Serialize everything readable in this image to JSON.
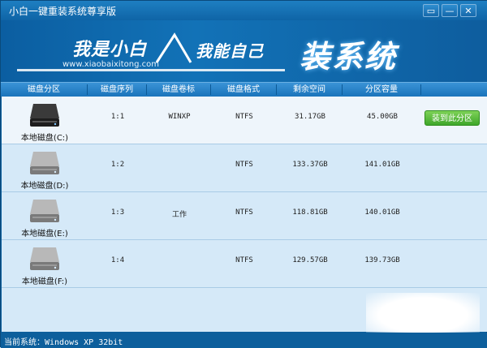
{
  "window": {
    "title": "小白一键重装系统尊享版",
    "controls": [
      "▭",
      "—",
      "✕"
    ]
  },
  "banner": {
    "slogan_left": "我是小白",
    "slogan_right": "我能自己",
    "site_url": "www.xiaobaixitong.com",
    "big_title": "装系统"
  },
  "columns": [
    "磁盘分区",
    "磁盘序列",
    "磁盘卷标",
    "磁盘格式",
    "剩余空间",
    "分区容量"
  ],
  "disks": [
    {
      "label": "本地磁盘(C:)",
      "serial": "1:1",
      "volume": "WINXP",
      "format": "NTFS",
      "free": "31.17GB",
      "capacity": "45.00GB",
      "action": "装到此分区",
      "selected": true
    },
    {
      "label": "本地磁盘(D:)",
      "serial": "1:2",
      "volume": "",
      "format": "NTFS",
      "free": "133.37GB",
      "capacity": "141.01GB"
    },
    {
      "label": "本地磁盘(E:)",
      "serial": "1:3",
      "volume": "工作",
      "format": "NTFS",
      "free": "118.81GB",
      "capacity": "140.01GB"
    },
    {
      "label": "本地磁盘(F:)",
      "serial": "1:4",
      "volume": "",
      "format": "NTFS",
      "free": "129.57GB",
      "capacity": "139.73GB"
    }
  ],
  "status": {
    "text": "当前系统：Windows XP 32bit"
  },
  "colors": {
    "frame": "#0d5f9c",
    "header": "#1a74bb",
    "row_bg": "#d5e9f8",
    "selected_row_bg": "#eef5fb",
    "action_button": "#4caf30"
  },
  "icons": {
    "drive": "hard-disk-icon",
    "feedback": "chat-bubble-icon",
    "minimize": "minimize-icon",
    "close": "close-icon"
  }
}
